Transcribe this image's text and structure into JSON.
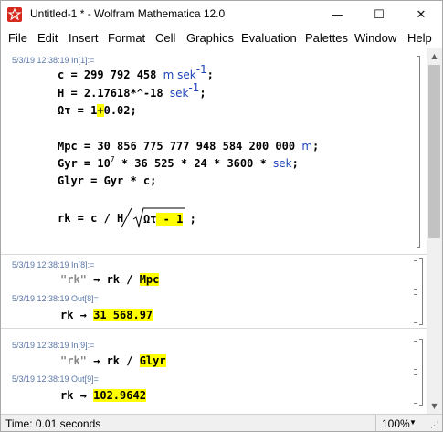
{
  "window": {
    "title": "Untitled-1 * - Wolfram Mathematica 12.0",
    "controls": {
      "minimize": "—",
      "maximize": "☐",
      "close": "✕"
    }
  },
  "menu": [
    "File",
    "Edit",
    "Insert",
    "Format",
    "Cell",
    "Graphics",
    "Evaluation",
    "Palettes",
    "Window",
    "Help"
  ],
  "cells": {
    "in1_label": "5/3/19 12:38:19 In[1]:=",
    "in8_label": "5/3/19 12:38:19 In[8]:=",
    "out8_label": "5/3/19 12:38:19 Out[8]=",
    "in9_label": "5/3/19 12:38:19 In[9]:=",
    "out9_label": "5/3/19 12:38:19 Out[9]="
  },
  "code": {
    "c_lhs": "c = 299 792 458 ",
    "c_unit": "m sek",
    "c_exp": "-1",
    "c_end": ";",
    "h_lhs": "H = 2.17618*^-18 ",
    "h_unit": "sek",
    "h_exp": "-1",
    "h_end": ";",
    "om_lhs": "Ωτ = 1",
    "om_plus": "+",
    "om_rest": "0.02;",
    "mpc_lhs": "Mpc = 30 856 775 777 948 584 200 000 ",
    "mpc_unit": "m",
    "mpc_end": ";",
    "gyr_a": "Gyr = 10",
    "gyr_exp": "7",
    "gyr_b": " * 36 525 * 24 * 3600 * ",
    "gyr_unit": "sek",
    "gyr_end": ";",
    "glyr": "Glyr = Gyr * c;",
    "rk_a": "rk = c / H",
    "rk_sqrt_a": "Ωτ",
    "rk_sqrt_b": " - 1",
    "rk_end": " ;"
  },
  "in8": {
    "q": "\"rk\"",
    "arrow": " → rk / ",
    "unit": "Mpc"
  },
  "out8": {
    "lhs": "rk → ",
    "value": "31 568.97"
  },
  "in9": {
    "q": "\"rk\"",
    "arrow": " → rk / ",
    "unit": "Glyr"
  },
  "out9": {
    "lhs": "rk → ",
    "value": "102.9642"
  },
  "status": {
    "time": "Time: 0.01 seconds",
    "zoom": "100%"
  },
  "colors": {
    "highlight": "#ffff00",
    "unit_blue": "#1d44b8",
    "label_blue": "#5a76a6"
  }
}
